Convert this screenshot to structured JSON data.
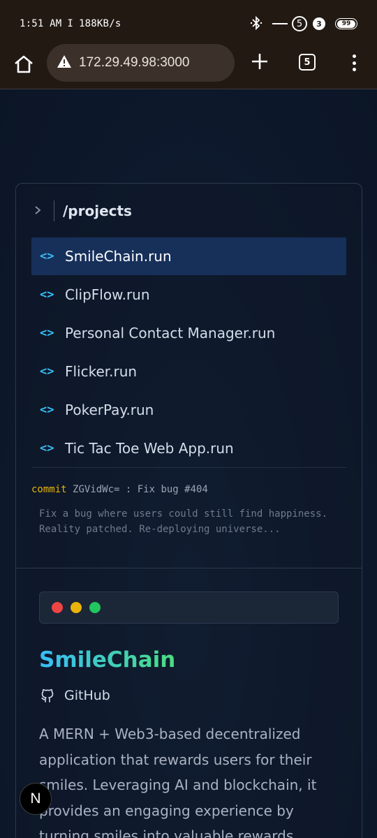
{
  "status_bar": {
    "time": "1:51 AM",
    "separator": "I",
    "speed": "188KB/s",
    "bluetooth_icon": "bluetooth-icon",
    "signal_badge": "5",
    "notif_badge": "3",
    "battery": "99"
  },
  "browser": {
    "url": "172.29.49.98:3000",
    "warning_icon": "warning-icon",
    "tab_count": "5"
  },
  "projects_panel": {
    "path": "/projects",
    "items": [
      {
        "label": "SmileChain.run",
        "icon": "<>"
      },
      {
        "label": "ClipFlow.run",
        "icon": "<>"
      },
      {
        "label": "Personal Contact Manager.run",
        "icon": "<>"
      },
      {
        "label": "Flicker.run",
        "icon": "<>"
      },
      {
        "label": "PokerPay.run",
        "icon": "<>"
      },
      {
        "label": "Tic Tac Toe Web App.run",
        "icon": "<>"
      }
    ],
    "active_index": 0
  },
  "commit": {
    "keyword": "commit",
    "hash_line": "ZGVidWc= : Fix bug #404",
    "message_line1": "Fix a bug where users could still find happiness.",
    "message_line2": "Reality patched. Re-deploying universe..."
  },
  "project_detail": {
    "window_dot_colors": [
      "#ef4444",
      "#eab308",
      "#22c55e"
    ],
    "title": "SmileChain",
    "github_label": "GitHub",
    "description": "A MERN + Web3-based decentralized application that rewards users for their smiles. Leveraging AI and blockchain, it provides an engaging experience by turning smiles into valuable rewards."
  },
  "floating_badge": "N"
}
